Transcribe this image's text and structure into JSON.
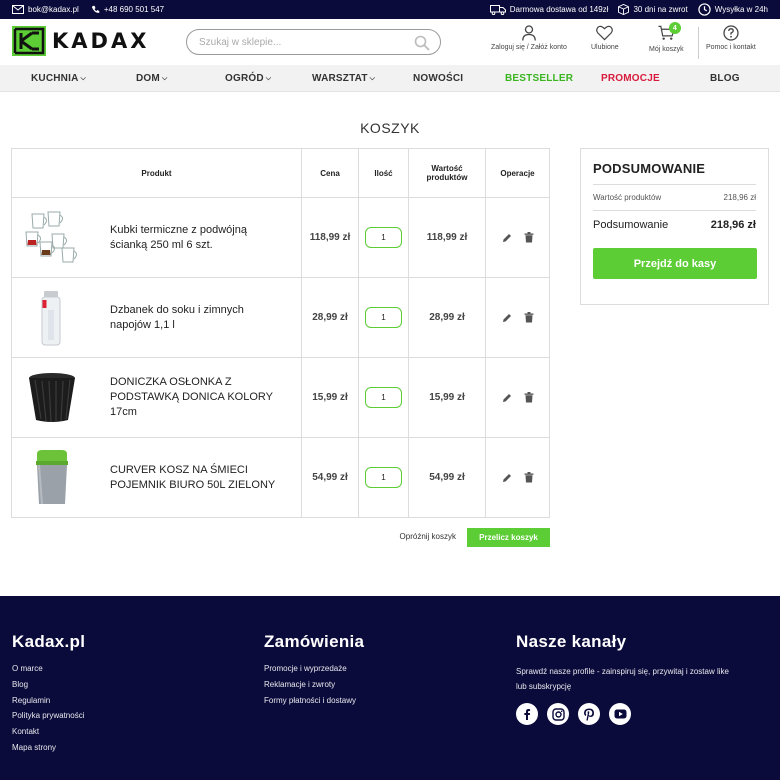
{
  "topbar": {
    "email": "bok@kadax.pl",
    "phone": "+48 690 501 547",
    "shipping": "Darmowa dostawa od 149zł",
    "returns": "30 dni na zwrot",
    "dispatch": "Wysyłka w 24h"
  },
  "header": {
    "logo_text": "KADAX",
    "search_placeholder": "Szukaj w sklepie...",
    "login_label": "Zaloguj się / Załóż konto",
    "favorites_label": "Ulubione",
    "cart_label": "Mój koszyk",
    "cart_count": "4",
    "help_label": "Pomoc i kontakt"
  },
  "nav": {
    "items": [
      {
        "label": "KUCHNIA",
        "dropdown": true
      },
      {
        "label": "DOM",
        "dropdown": true
      },
      {
        "label": "OGRÓD",
        "dropdown": true
      },
      {
        "label": "WARSZTAT",
        "dropdown": true
      },
      {
        "label": "NOWOŚCI"
      },
      {
        "label": "BESTSELLER",
        "color": "#3ab520"
      },
      {
        "label": "PROMOCJE",
        "color": "#d81b3c"
      },
      {
        "label": "BLOG"
      }
    ]
  },
  "page": {
    "title": "KOSZYK"
  },
  "cart": {
    "headers": {
      "product": "Produkt",
      "price": "Cena",
      "quantity": "Ilość",
      "value": "Wartość produktów",
      "operations": "Operacje"
    },
    "items": [
      {
        "name": "Kubki termiczne z podwójną ścianką 250 ml 6 szt.",
        "price": "118,99 zł",
        "qty": "1",
        "value": "118,99 zł"
      },
      {
        "name": "Dzbanek do soku i zimnych napojów 1,1 l",
        "price": "28,99 zł",
        "qty": "1",
        "value": "28,99 zł"
      },
      {
        "name": "DONICZKA OSŁONKA Z PODSTAWKĄ DONICA KOLORY 17cm",
        "price": "15,99 zł",
        "qty": "1",
        "value": "15,99 zł"
      },
      {
        "name": "CURVER KOSZ NA ŚMIECI POJEMNIK BIURO 50L ZIELONY",
        "price": "54,99 zł",
        "qty": "1",
        "value": "54,99 zł"
      }
    ],
    "empty_label": "Opróżnij koszyk",
    "recalc_label": "Przelicz koszyk"
  },
  "summary": {
    "title": "PODSUMOWANIE",
    "products_label": "Wartość produktów",
    "products_value": "218,96 zł",
    "total_label": "Podsumowanie",
    "total_value": "218,96 zł",
    "checkout_label": "Przejdź do kasy"
  },
  "footer": {
    "col1": {
      "title": "Kadax.pl",
      "links": [
        "O marce",
        "Blog",
        "Regulamin",
        "Polityka prywatności",
        "Kontakt",
        "Mapa strony"
      ]
    },
    "col2": {
      "title": "Zamówienia",
      "links": [
        "Promocje i wyprzedaże",
        "Reklamacje i zwroty",
        "Formy płatności i dostawy"
      ]
    },
    "col3": {
      "title": "Nasze kanały",
      "description": "Sprawdź nasze profile - zainspiruj się, przywitaj i zostaw like lub subskrypcję",
      "socials": [
        "facebook-icon",
        "instagram-icon",
        "pinterest-icon",
        "youtube-icon"
      ]
    }
  },
  "colors": {
    "brand_green": "#5ccd34",
    "navy": "#0b0b3b",
    "promo_red": "#d81b3c"
  }
}
